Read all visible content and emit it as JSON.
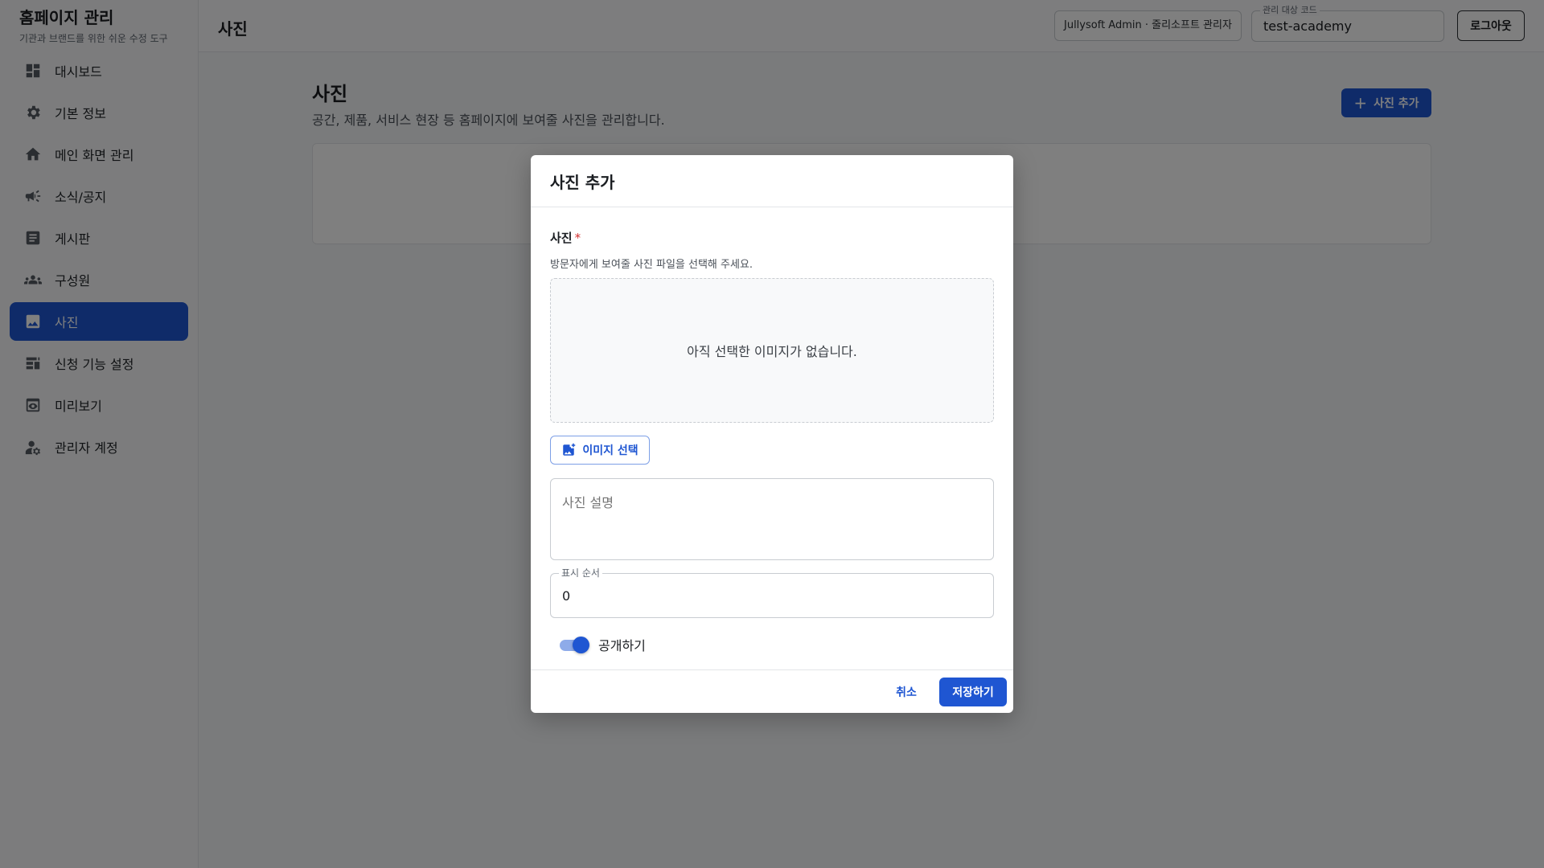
{
  "sidebar": {
    "brand_title": "홈페이지 관리",
    "brand_subtitle": "기관과 브랜드를 위한 쉬운 수정 도구",
    "items": [
      {
        "label": "대시보드",
        "icon": "dashboard-icon"
      },
      {
        "label": "기본 정보",
        "icon": "gear-icon"
      },
      {
        "label": "메인 화면 관리",
        "icon": "home-icon"
      },
      {
        "label": "소식/공지",
        "icon": "megaphone-icon"
      },
      {
        "label": "게시판",
        "icon": "article-icon"
      },
      {
        "label": "구성원",
        "icon": "people-icon"
      },
      {
        "label": "사진",
        "icon": "image-icon",
        "active": true
      },
      {
        "label": "신청 기능 설정",
        "icon": "form-settings-icon"
      },
      {
        "label": "미리보기",
        "icon": "preview-icon"
      },
      {
        "label": "관리자 계정",
        "icon": "admin-account-icon"
      }
    ]
  },
  "header": {
    "title": "사진",
    "user_chip": "Jullysoft Admin · 줄리소프트 관리자",
    "code_label": "관리 대상 코드",
    "code_value": "test-academy",
    "logout_label": "로그아웃"
  },
  "main": {
    "title": "사진",
    "description": "공간, 제품, 서비스 현장 등 홈페이지에 보여줄 사진을 관리합니다.",
    "add_button_label": "사진 추가"
  },
  "modal": {
    "title": "사진 추가",
    "photo_label": "사진",
    "required_mark": "*",
    "photo_help": "방문자에게 보여줄 사진 파일을 선택해 주세요.",
    "empty_image_text": "아직 선택한 이미지가 없습니다.",
    "select_image_label": "이미지 선택",
    "description_placeholder": "사진 설명",
    "order_label": "표시 순서",
    "order_value": "0",
    "publish_label": "공개하기",
    "publish_on": true,
    "cancel_label": "취소",
    "save_label": "저장하기"
  },
  "colors": {
    "accent": "#1f56d2",
    "overlay": "rgba(0,0,0,0.5)"
  }
}
